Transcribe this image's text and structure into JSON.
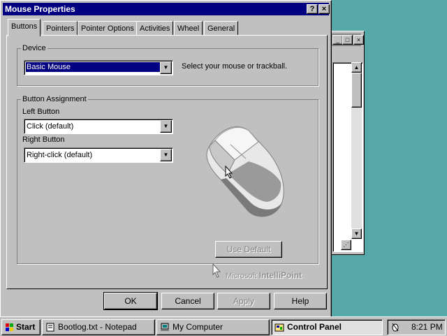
{
  "dialog": {
    "title": "Mouse Properties",
    "help_button": "?",
    "close_button": "×",
    "tabs": [
      {
        "label": "Buttons"
      },
      {
        "label": "Pointers"
      },
      {
        "label": "Pointer Options"
      },
      {
        "label": "Activities"
      },
      {
        "label": "Wheel"
      },
      {
        "label": "General"
      }
    ],
    "device": {
      "group_label": "Device",
      "selected": "Basic Mouse",
      "hint": "Select your mouse or trackball."
    },
    "button_assignment": {
      "group_label": "Button Assignment",
      "left_label": "Left Button",
      "left_value": "Click (default)",
      "right_label": "Right Button",
      "right_value": "Right-click (default)",
      "use_default": "Use Default"
    },
    "brand": {
      "prefix": "Microsoft",
      "name": "IntelliPoint"
    },
    "footer": {
      "ok": "OK",
      "cancel": "Cancel",
      "apply": "Apply",
      "help": "Help"
    }
  },
  "background_window": {
    "scroll_up": "▲",
    "scroll_down": "▼"
  },
  "taskbar": {
    "start": "Start",
    "items": [
      {
        "label": "Bootlog.txt - Notepad"
      },
      {
        "label": "My Computer"
      },
      {
        "label": "Control Panel"
      }
    ],
    "clock": "8:21 PM"
  },
  "colors": {
    "desktop": "#57a8a8",
    "title_active": "#000080",
    "face": "#c0c0c0"
  }
}
